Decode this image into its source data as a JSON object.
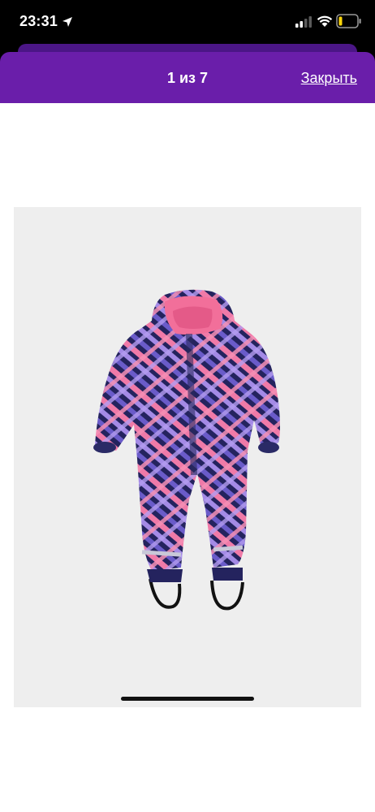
{
  "status_bar": {
    "time": "23:31",
    "icons": [
      "location-arrow-icon",
      "signal-icon",
      "wifi-icon",
      "battery-low-icon"
    ],
    "battery_color": "#ffd60a"
  },
  "header": {
    "title": "1 из 7",
    "close_label": "Закрыть",
    "background": "#6a1eaa"
  },
  "gallery": {
    "current_index": 1,
    "total": 7,
    "image_subject": "children's winter jumpsuit"
  }
}
